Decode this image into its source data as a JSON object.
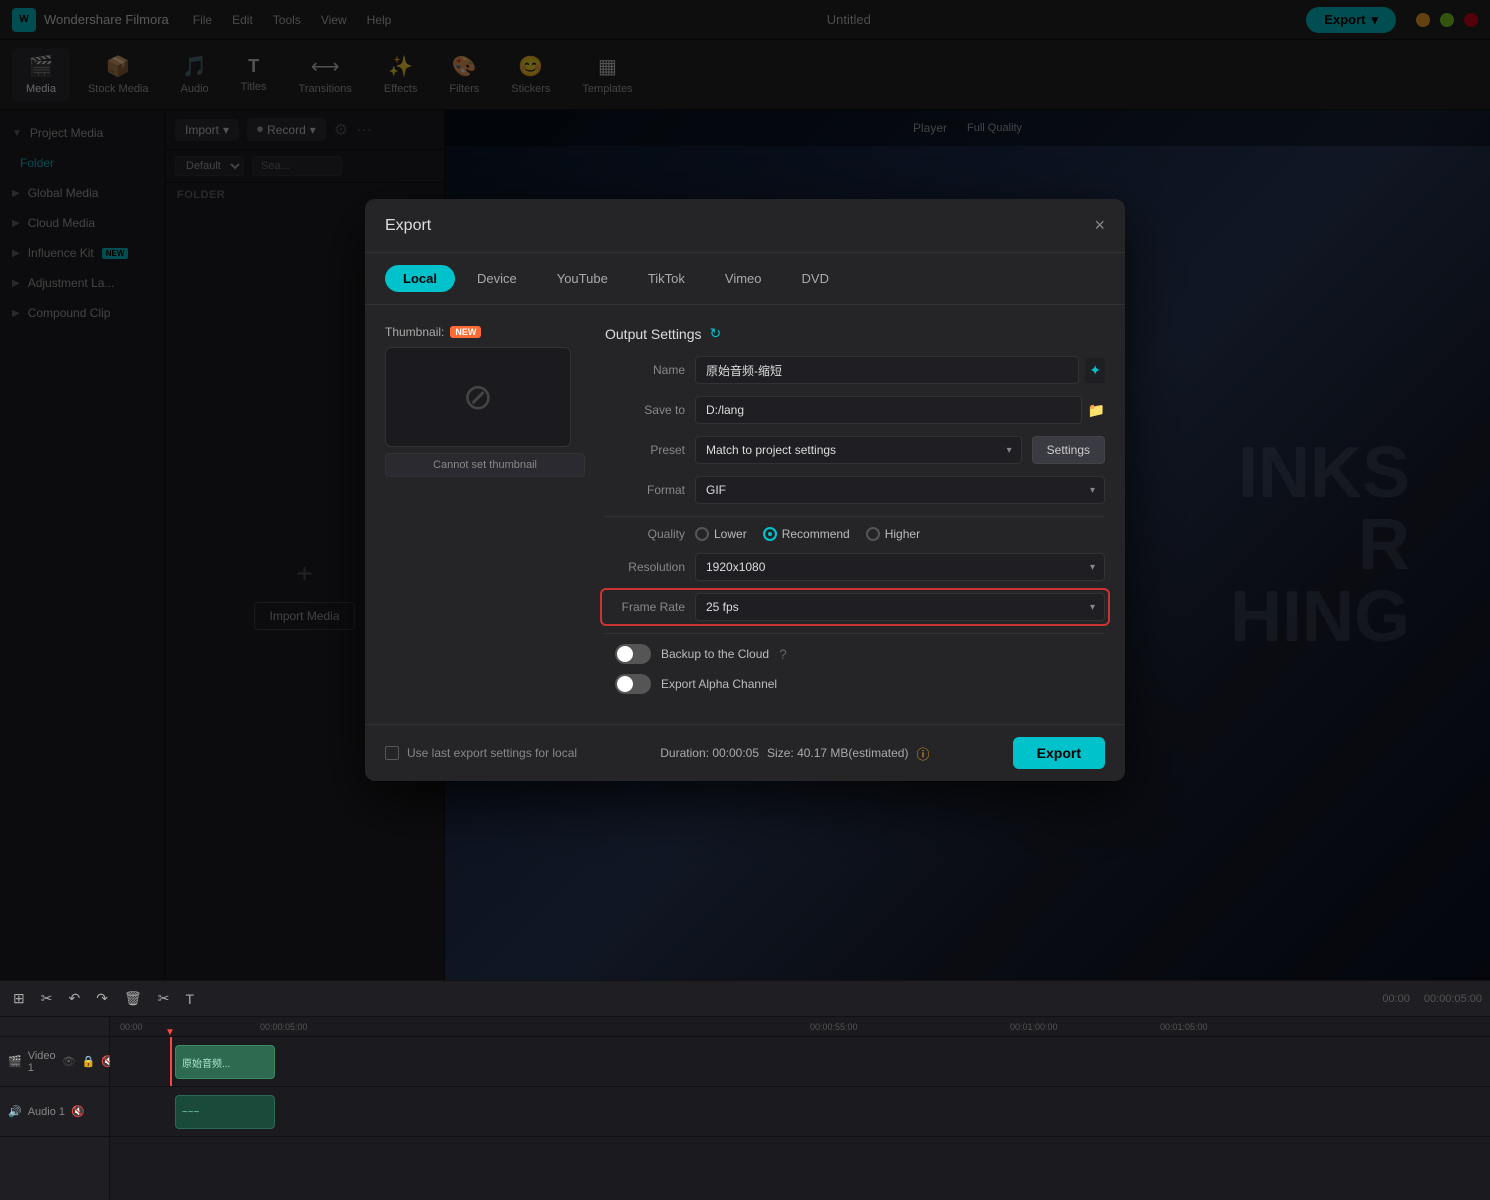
{
  "app": {
    "name": "Wondershare Filmora",
    "title": "Untitled",
    "logo": "W"
  },
  "titlebar": {
    "menu": [
      "File",
      "Edit",
      "Tools",
      "View",
      "Help"
    ],
    "export_label": "Export",
    "export_arrow": "▾"
  },
  "toolbar": {
    "items": [
      {
        "id": "media",
        "icon": "🎬",
        "label": "Media",
        "active": true
      },
      {
        "id": "stock-media",
        "icon": "📦",
        "label": "Stock Media"
      },
      {
        "id": "audio",
        "icon": "🎵",
        "label": "Audio"
      },
      {
        "id": "titles",
        "icon": "T",
        "label": "Titles"
      },
      {
        "id": "transitions",
        "icon": "⟷",
        "label": "Transitions"
      },
      {
        "id": "effects",
        "icon": "✨",
        "label": "Effects"
      },
      {
        "id": "filters",
        "icon": "🎨",
        "label": "Filters"
      },
      {
        "id": "stickers",
        "icon": "😊",
        "label": "Stickers"
      },
      {
        "id": "templates",
        "icon": "▦",
        "label": "Templates"
      }
    ]
  },
  "sidebar": {
    "items": [
      {
        "id": "project-media",
        "label": "Project Media",
        "expanded": true
      },
      {
        "id": "folder",
        "label": "Folder",
        "indent": true
      },
      {
        "id": "global-media",
        "label": "Global Media"
      },
      {
        "id": "cloud-media",
        "label": "Cloud Media"
      },
      {
        "id": "influence-kit",
        "label": "Influence Kit",
        "badge": "NEW"
      },
      {
        "id": "adjustment-la",
        "label": "Adjustment La..."
      },
      {
        "id": "compound-clip",
        "label": "Compound Clip"
      }
    ]
  },
  "media_panel": {
    "import_label": "Import",
    "record_label": "Record",
    "default_label": "Default",
    "search_placeholder": "Sea...",
    "folder_header": "FOLDER",
    "import_media_label": "Import Media",
    "add_icon": "+"
  },
  "player": {
    "label": "Player",
    "quality": "Full Quality"
  },
  "preview_text": "INKS\nR\nHING",
  "timeline": {
    "tracks": [
      {
        "id": "video-1",
        "label": "Video 1",
        "icon": "🎬"
      },
      {
        "id": "audio-1",
        "label": "Audio 1",
        "icon": "🔊"
      }
    ],
    "clip_name": "原始音频...",
    "time_markers": [
      "00:00",
      "00:00:05:00",
      "00:00:55:00",
      "00:01:00:00",
      "00:01:05:00"
    ]
  },
  "export_dialog": {
    "title": "Export",
    "close_label": "×",
    "tabs": [
      {
        "id": "local",
        "label": "Local",
        "active": true
      },
      {
        "id": "device",
        "label": "Device"
      },
      {
        "id": "youtube",
        "label": "YouTube"
      },
      {
        "id": "tiktok",
        "label": "TikTok"
      },
      {
        "id": "vimeo",
        "label": "Vimeo"
      },
      {
        "id": "dvd",
        "label": "DVD"
      }
    ],
    "thumbnail_label": "Thumbnail:",
    "new_badge": "NEW",
    "cannot_set_label": "Cannot set thumbnail",
    "output_title": "Output Settings",
    "name_label": "Name",
    "name_value": "原始音频-缩短",
    "save_to_label": "Save to",
    "save_to_value": "D:/lang",
    "preset_label": "Preset",
    "preset_value": "Match to project settings",
    "format_label": "Format",
    "format_value": "GIF",
    "quality_label": "Quality",
    "quality_options": [
      {
        "id": "lower",
        "label": "Lower",
        "checked": false
      },
      {
        "id": "recommend",
        "label": "Recommend",
        "checked": true
      },
      {
        "id": "higher",
        "label": "Higher",
        "checked": false
      }
    ],
    "resolution_label": "Resolution",
    "resolution_value": "1920x1080",
    "frame_rate_label": "Frame Rate",
    "frame_rate_value": "25 fps",
    "backup_cloud_label": "Backup to the Cloud",
    "backup_cloud_on": false,
    "export_alpha_label": "Export Alpha Channel",
    "export_alpha_on": false,
    "settings_btn": "Settings",
    "use_last_label": "Use last export settings for local",
    "duration_label": "Duration:",
    "duration_value": "00:00:05",
    "size_label": "Size:",
    "size_value": "40.17 MB(estimated)",
    "export_label": "Export"
  }
}
